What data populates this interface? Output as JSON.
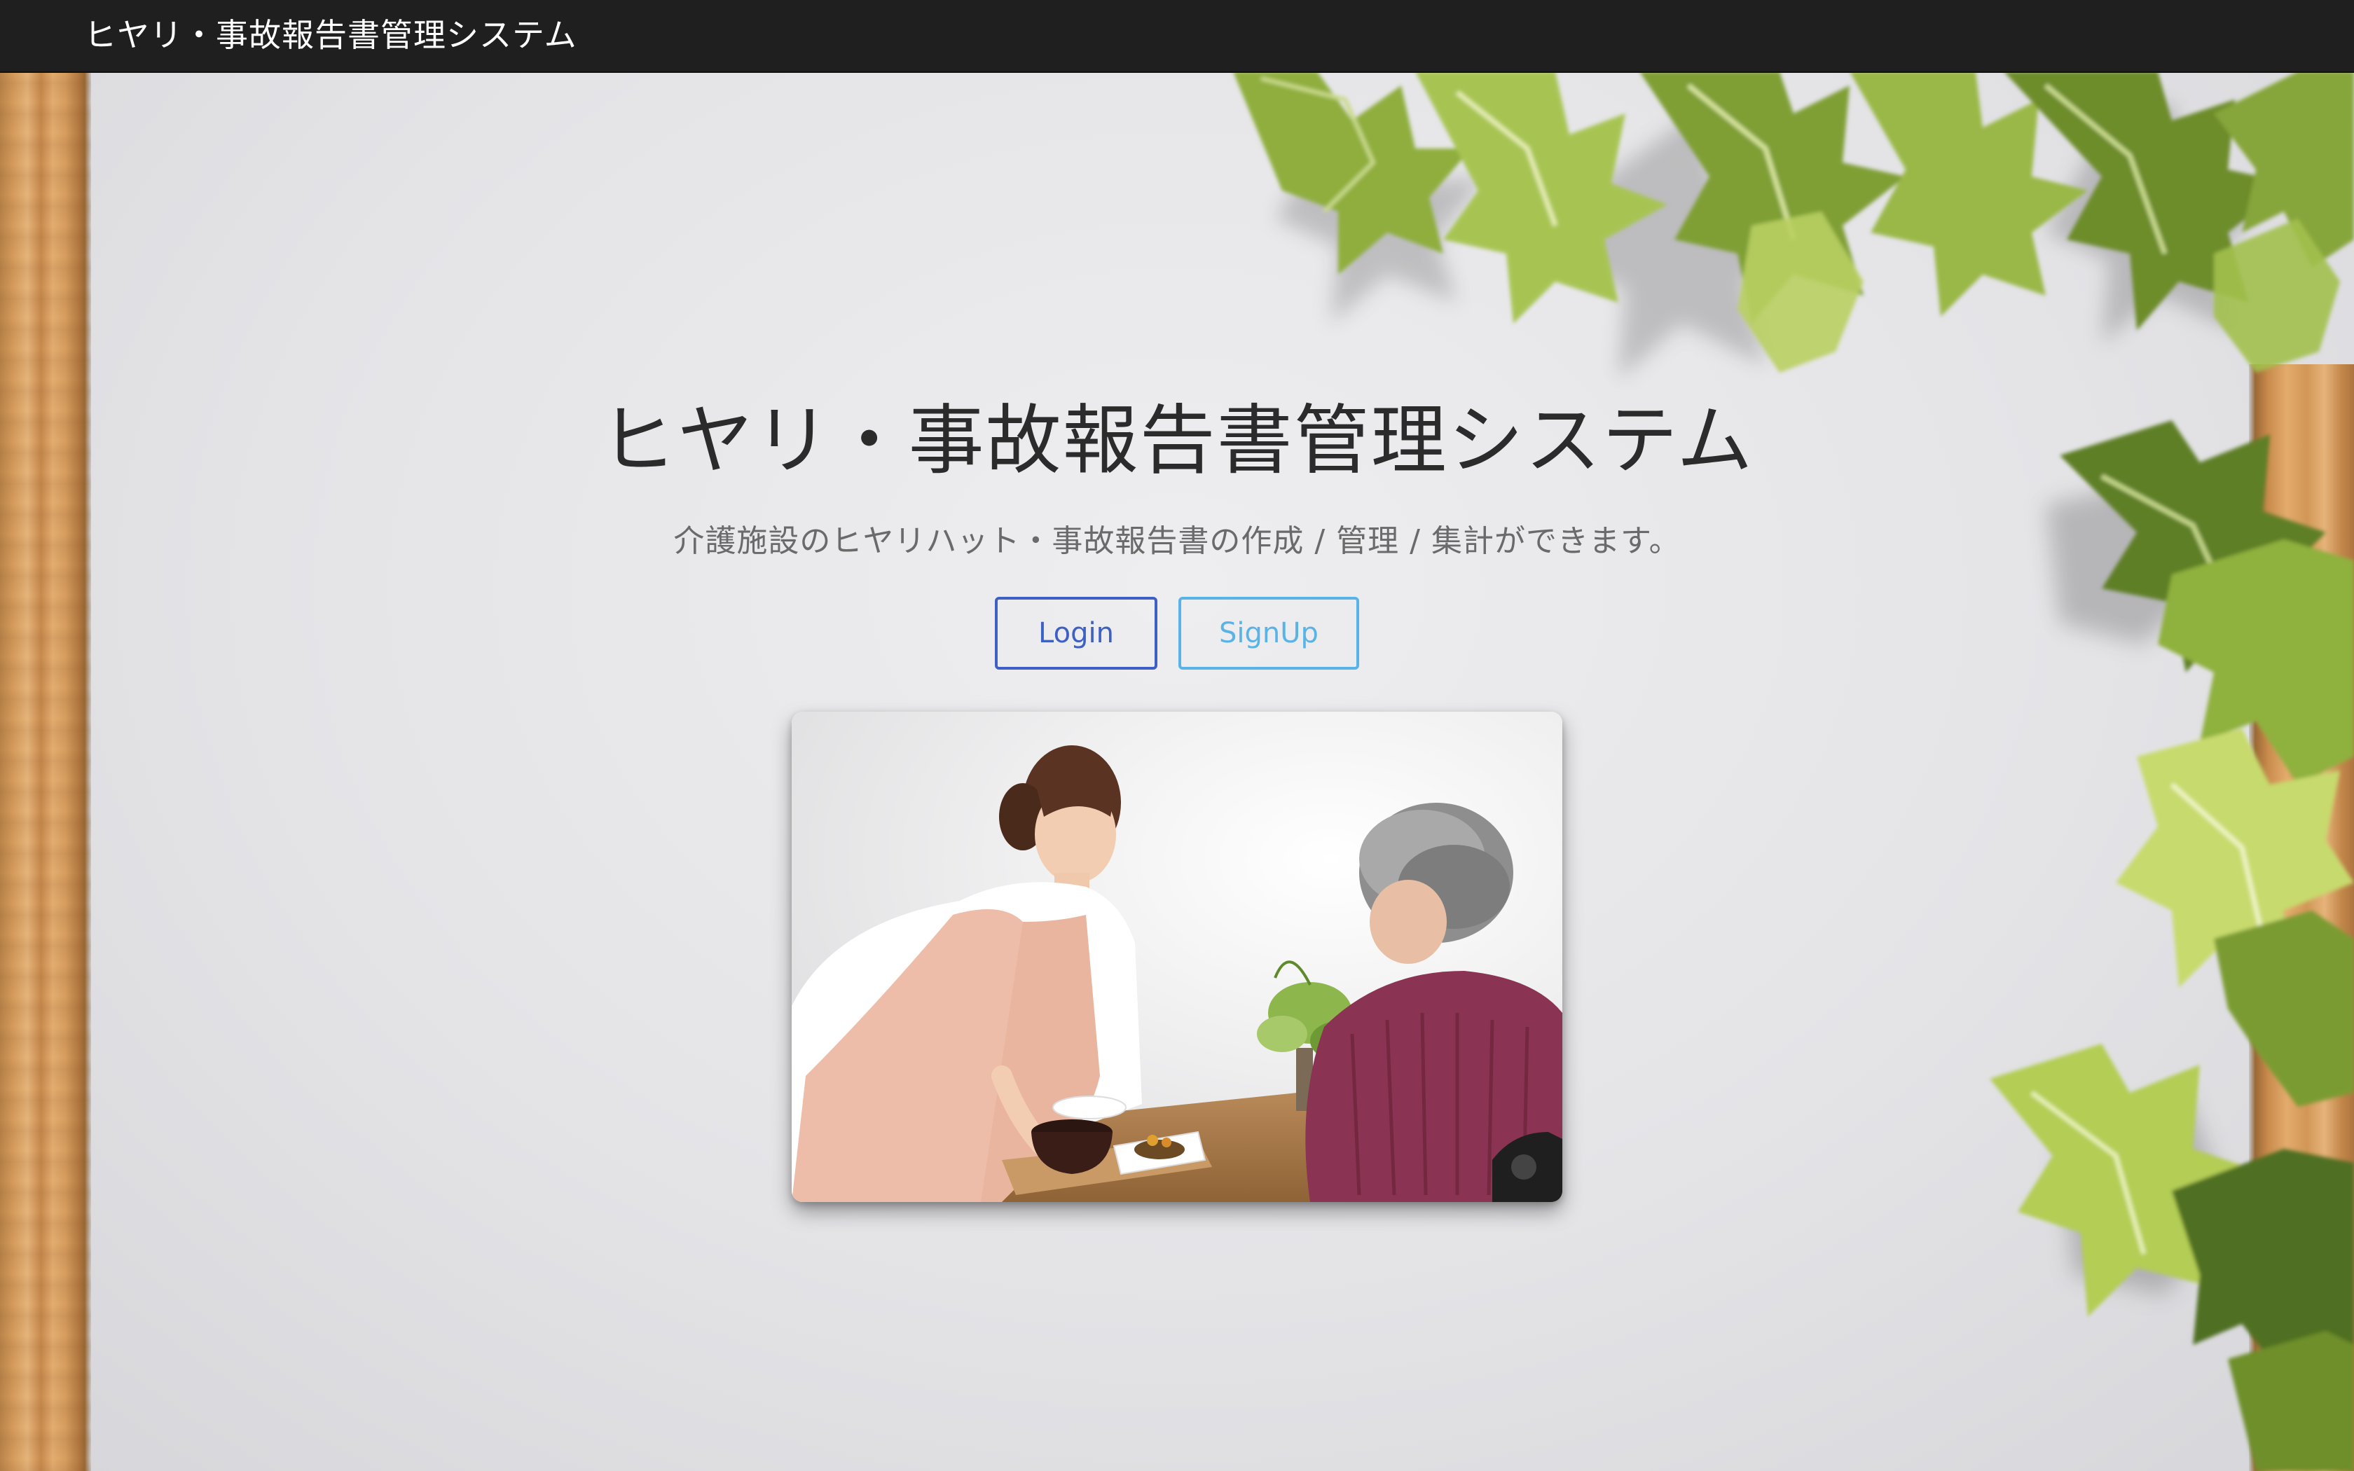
{
  "navbar": {
    "brand": "ヒヤリ・事故報告書管理システム"
  },
  "hero": {
    "title": "ヒヤリ・事故報告書管理システム",
    "subtitle": "介護施設のヒヤリハット・事故報告書の作成 / 管理 / 集計ができます。",
    "login_label": "Login",
    "signup_label": "SignUp"
  },
  "colors": {
    "navbar_bg": "#1f1f1f",
    "login_accent": "#3e5fc4",
    "signup_accent": "#5ab3e6",
    "page_bg": "#e4e4e7"
  }
}
